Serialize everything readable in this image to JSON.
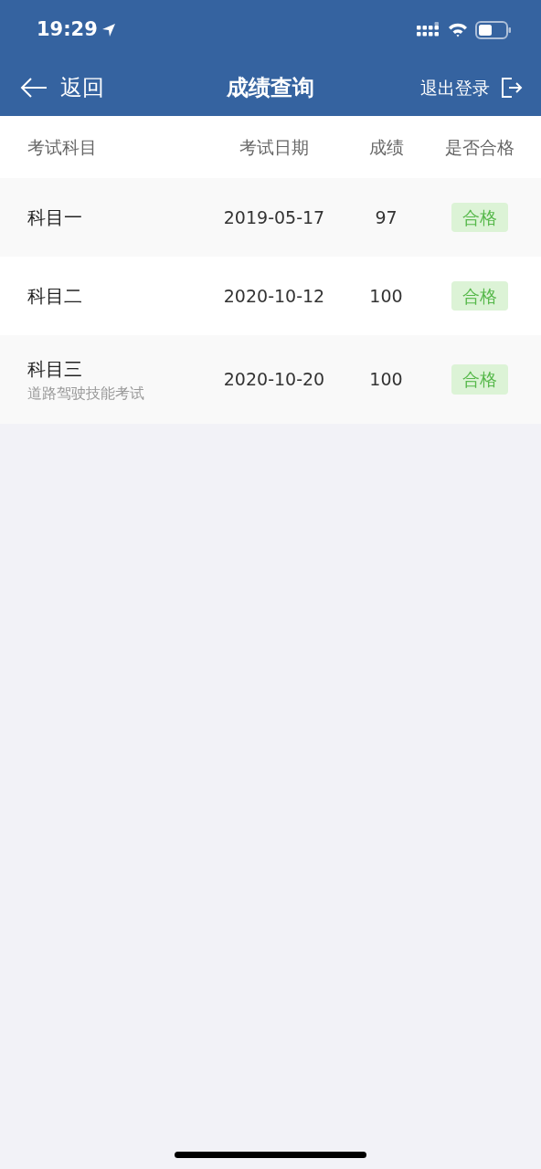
{
  "status_bar": {
    "time": "19:29"
  },
  "nav": {
    "back": "返回",
    "title": "成绩查询",
    "logout": "退出登录"
  },
  "table": {
    "columns": [
      "考试科目",
      "考试日期",
      "成绩",
      "是否合格"
    ],
    "rows": [
      {
        "subject": "科目一",
        "date": "2019-05-17",
        "score": "97",
        "result": "合格"
      },
      {
        "subject": "科目二",
        "date": "2020-10-12",
        "score": "100",
        "result": "合格"
      },
      {
        "subject": "科目三",
        "subtitle": "道路驾驶技能考试",
        "date": "2020-10-20",
        "score": "100",
        "result": "合格"
      }
    ]
  }
}
